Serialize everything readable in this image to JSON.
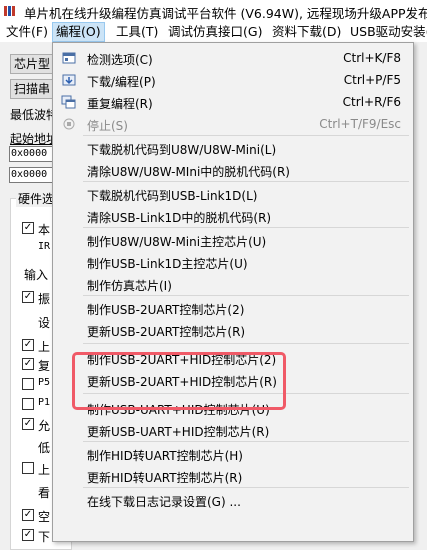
{
  "window": {
    "title": "单片机在线升级编程仿真调试平台软件 (V6.94W), 远程现场升级APP发布"
  },
  "menubar": {
    "items": [
      {
        "label": "文件(F)"
      },
      {
        "label": "编程(O)"
      },
      {
        "label": "工具(T)"
      },
      {
        "label": "调试仿真接口(G)"
      },
      {
        "label": "资料下载(D)"
      },
      {
        "label": "USB驱动安装("
      }
    ]
  },
  "background": {
    "chip_model_btn": "芯片型",
    "scan_btn": "扫描串",
    "baud_label": "最低波特",
    "start_addr_label": "起始地址",
    "addr1": "0x0000",
    "addr2": "0x0000",
    "hw_group_title": "硬件选",
    "options": [
      {
        "label": "本",
        "checked": true
      },
      {
        "label": "IR",
        "checked": null,
        "mono": true
      },
      {
        "label": "输入",
        "checked": null
      },
      {
        "label": "振",
        "checked": true
      },
      {
        "label": "设",
        "checked": null
      },
      {
        "label": "上",
        "checked": true
      },
      {
        "label": "复",
        "checked": true
      },
      {
        "label": "P5",
        "checked": false,
        "mono": true
      },
      {
        "label": "P1",
        "checked": false,
        "mono": true
      },
      {
        "label": "允",
        "checked": true
      },
      {
        "label": "低",
        "checked": null
      },
      {
        "label": "上",
        "checked": false
      },
      {
        "label": "看",
        "checked": null
      },
      {
        "label": "空",
        "checked": true
      },
      {
        "label": "下",
        "checked": true
      }
    ]
  },
  "dropdown": {
    "items": [
      {
        "label": "检测选项(C)",
        "shortcut": "Ctrl+K/F8",
        "icon": "check-options-icon"
      },
      {
        "label": "下载/编程(P)",
        "shortcut": "Ctrl+P/F5",
        "icon": "download-icon"
      },
      {
        "label": "重复编程(R)",
        "shortcut": "Ctrl+R/F6",
        "icon": "repeat-program-icon"
      },
      {
        "label": "停止(S)",
        "shortcut": "Ctrl+T/F9/Esc",
        "icon": "stop-icon",
        "disabled": true
      },
      {
        "label": "下载脱机代码到U8W/U8W-Mini(L)"
      },
      {
        "label": "清除U8W/U8W-MIni中的脱机代码(R)"
      },
      {
        "label": "下载脱机代码到USB-Link1D(L)"
      },
      {
        "label": "清除USB-Link1D中的脱机代码(R)"
      },
      {
        "label": "制作U8W/U8W-Mini主控芯片(U)"
      },
      {
        "label": "制作USB-Link1D主控芯片(U)"
      },
      {
        "label": "制作仿真芯片(I)"
      },
      {
        "label": "制作USB-2UART控制芯片(2)"
      },
      {
        "label": "更新USB-2UART控制芯片(R)"
      },
      {
        "label": "制作USB-2UART+HID控制芯片(2)"
      },
      {
        "label": "更新USB-2UART+HID控制芯片(R)"
      },
      {
        "label": "制作USB-UART+HID控制芯片(U)"
      },
      {
        "label": "更新USB-UART+HID控制芯片(R)"
      },
      {
        "label": "制作HID转UART控制芯片(H)"
      },
      {
        "label": "更新HID转UART控制芯片(R)"
      },
      {
        "label": "在线下载日志记录设置(G) ..."
      }
    ]
  },
  "colors": {
    "highlight": "#f05a67",
    "menu_active": "#cce4f7"
  }
}
